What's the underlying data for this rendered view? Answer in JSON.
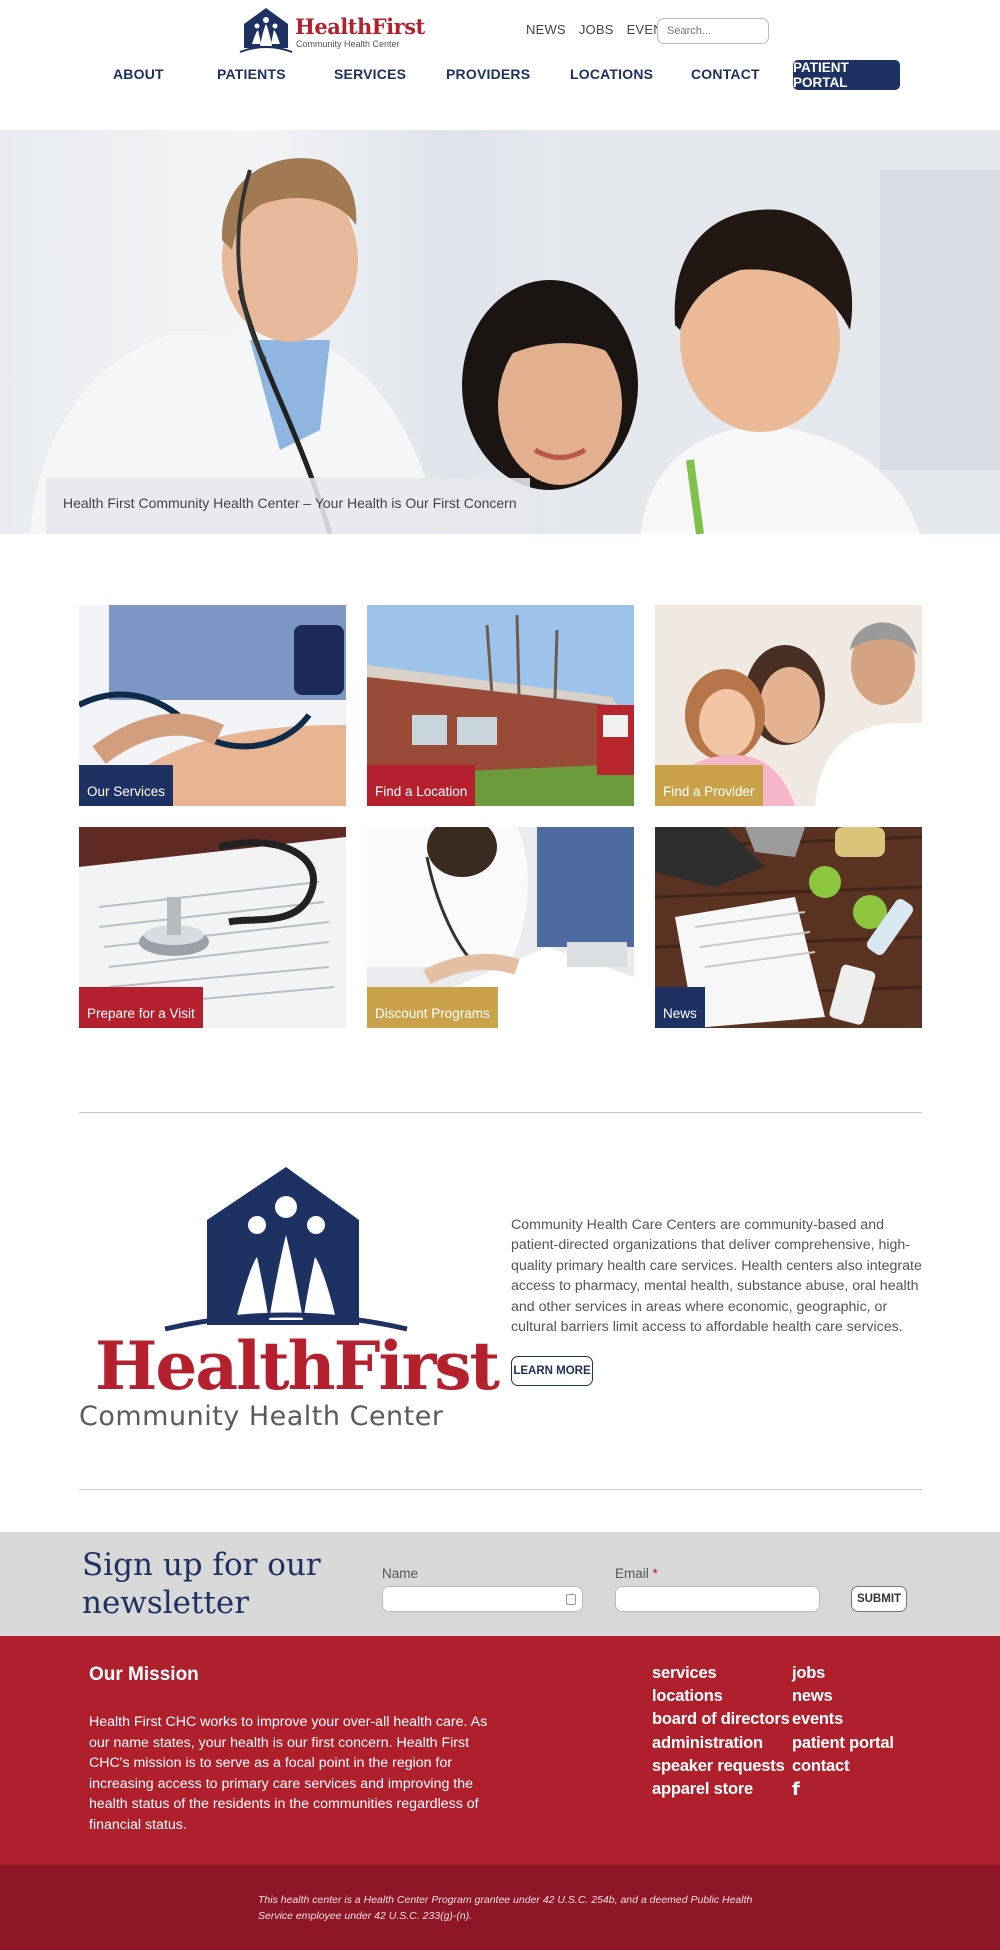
{
  "brand": {
    "name": "HealthFirst",
    "subtitle": "Community Health Center",
    "colors": {
      "navy": "#1e3163",
      "red": "#b5202e",
      "gold": "#c9a24a",
      "footer": "#b01f2c",
      "subfooter": "#8e1626"
    }
  },
  "utility_nav": {
    "news": "NEWS",
    "jobs": "JOBS",
    "events": "EVENTS"
  },
  "search": {
    "placeholder": "Search..."
  },
  "main_nav": {
    "about": "ABOUT",
    "patients": "PATIENTS",
    "services": "SERVICES",
    "providers": "PROVIDERS",
    "locations": "LOCATIONS",
    "contact": "CONTACT",
    "patient_portal": "PATIENT PORTAL"
  },
  "hero": {
    "caption": "Health First Community Health Center – Your Health is Our First Concern"
  },
  "tiles": [
    {
      "label": "Our Services",
      "color": "#1e3163",
      "image": "blood-pressure-check"
    },
    {
      "label": "Find a Location",
      "color": "#b5202e",
      "image": "brick-health-center-building"
    },
    {
      "label": "Find a Provider",
      "color": "#c9a24a",
      "image": "doctor-with-mother-and-daughter"
    },
    {
      "label": "Prepare for a Visit",
      "color": "#b5202e",
      "image": "stethoscope-on-forms"
    },
    {
      "label": "Discount Programs",
      "color": "#c9a24a",
      "image": "doctor-writing-form"
    },
    {
      "label": "News",
      "color": "#1e3163",
      "image": "sneakers-apples-notebook"
    }
  ],
  "about": {
    "text": "Community Health Care Centers are community-based and patient-directed organizations that deliver comprehensive, high-quality primary health care services. Health centers also integrate access to pharmacy, mental health, substance abuse, oral health and other services in areas where economic, geographic, or cultural barriers limit access to affordable health care services.",
    "button": "LEARN MORE"
  },
  "newsletter": {
    "title": "Sign up for our newsletter",
    "name_label": "Name",
    "email_label": "Email",
    "required_mark": "*",
    "name_value": "",
    "email_value": "",
    "submit": "SUBMIT"
  },
  "footer": {
    "mission_title": "Our Mission",
    "mission_text": "Health First CHC works to improve your over-all health care. As our name states, your health is our first concern. Health First CHC's mission is to serve as a focal point in the region for increasing access to primary care services and improving the health status of the residents in the communities regardless of financial status.",
    "links_col1": [
      "services",
      "locations",
      "board of directors",
      "administration",
      "speaker requests",
      "apparel store"
    ],
    "links_col2": [
      "jobs",
      "news",
      "events",
      "patient portal",
      "contact"
    ],
    "social_icon": "facebook-icon",
    "legal": "This health center is a Health Center Program grantee under 42 U.S.C. 254b, and a deemed Public Health Service employee under 42 U.S.C. 233(g)-(n)."
  }
}
